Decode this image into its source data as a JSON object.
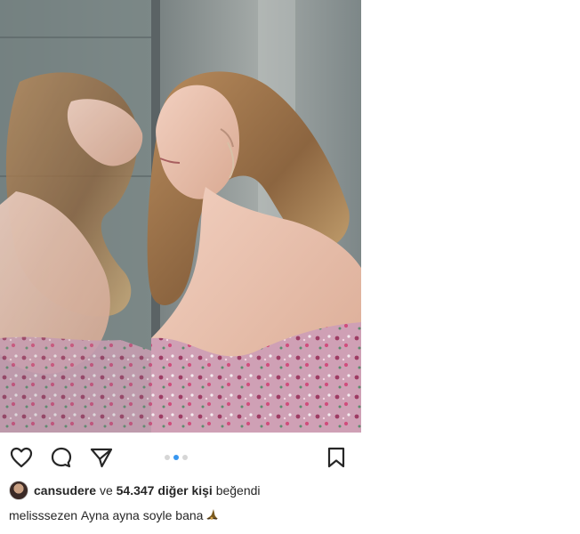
{
  "post": {
    "actions": {
      "like_icon": "heart-outline-icon",
      "comment_icon": "comment-bubble-icon",
      "share_icon": "paper-plane-icon",
      "save_icon": "bookmark-outline-icon",
      "carousel": {
        "total": 3,
        "active": 2
      }
    },
    "likes": {
      "username": "cansudere",
      "connector": "ve",
      "count_text": "54.347 diğer kişi",
      "suffix": "beğendi"
    },
    "caption": {
      "username": "melisssezen",
      "text": "Ayna ayna soyle bana",
      "emoji": "witch-hat-icon"
    },
    "colors": {
      "active_dot": "#3897f0",
      "inactive_dot": "#d6d6d6",
      "text": "#262626"
    }
  }
}
